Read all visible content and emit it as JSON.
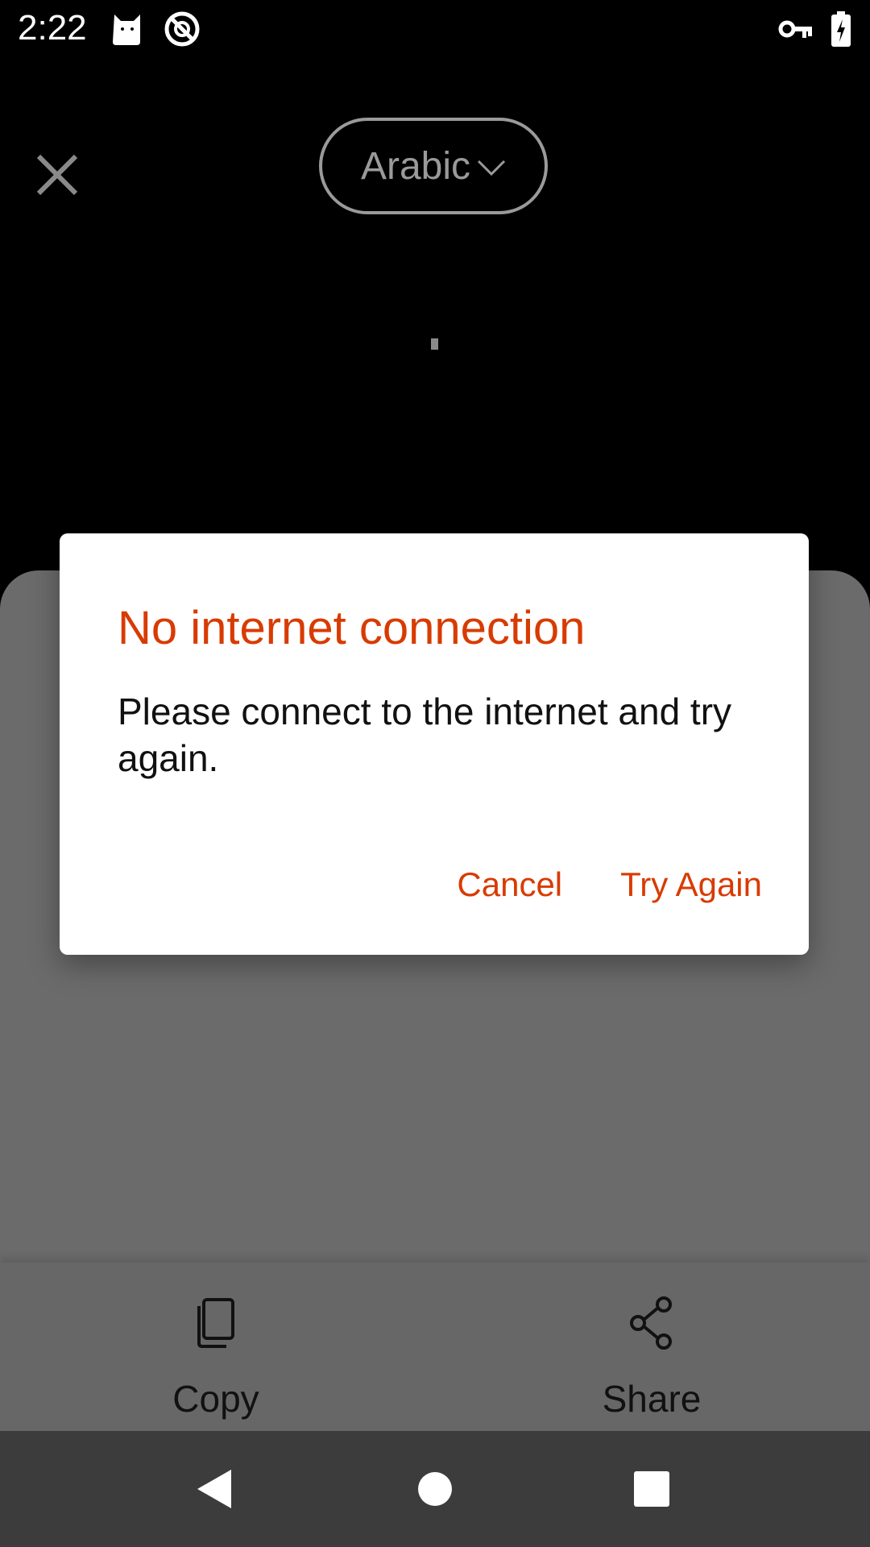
{
  "status_bar": {
    "time": "2:22",
    "icons": [
      "cat-icon",
      "blocked-icon",
      "vpn-key-icon",
      "battery-charging-icon"
    ]
  },
  "top_bar": {
    "close_icon": "close-icon",
    "language": "Arabic",
    "language_dropdown_icon": "chevron-down-icon"
  },
  "actions": {
    "copy_label": "Copy",
    "copy_icon": "copy-icon",
    "share_label": "Share",
    "share_icon": "share-icon"
  },
  "dialog": {
    "title": "No internet connection",
    "message": "Please connect to the internet and try again.",
    "cancel_label": "Cancel",
    "retry_label": "Try Again"
  },
  "nav_bar": {
    "icons": [
      "back-icon",
      "home-icon",
      "recents-icon"
    ]
  },
  "colors": {
    "accent": "#d83b01",
    "sheet_dimmed": "#6b6b6b",
    "nav_bar": "#3c3c3c"
  }
}
